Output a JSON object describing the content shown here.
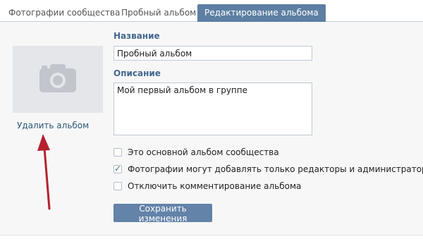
{
  "tabs": [
    {
      "label": "Фотографии сообщества"
    },
    {
      "label": "Пробный альбом"
    },
    {
      "label": "Редактирование альбома"
    }
  ],
  "cover": {
    "icon": "camera-icon",
    "delete_label": "Удалить альбом"
  },
  "form": {
    "name_label": "Название",
    "name_value": "Пробный альбом",
    "desc_label": "Описание",
    "desc_value": "Мой первый альбом в группе",
    "options": [
      {
        "label": "Это основной альбом сообщества",
        "checked": false
      },
      {
        "label": "Фотографии могут добавлять только редакторы и администраторы",
        "checked": true
      },
      {
        "label": "Отключить комментирование альбома",
        "checked": false
      }
    ],
    "save_label": "Сохранить изменения"
  },
  "colors": {
    "accent": "#5d7fa3",
    "button": "#6383a8",
    "link": "#2b587a",
    "label": "#45688e",
    "arrow": "#b5202f"
  }
}
